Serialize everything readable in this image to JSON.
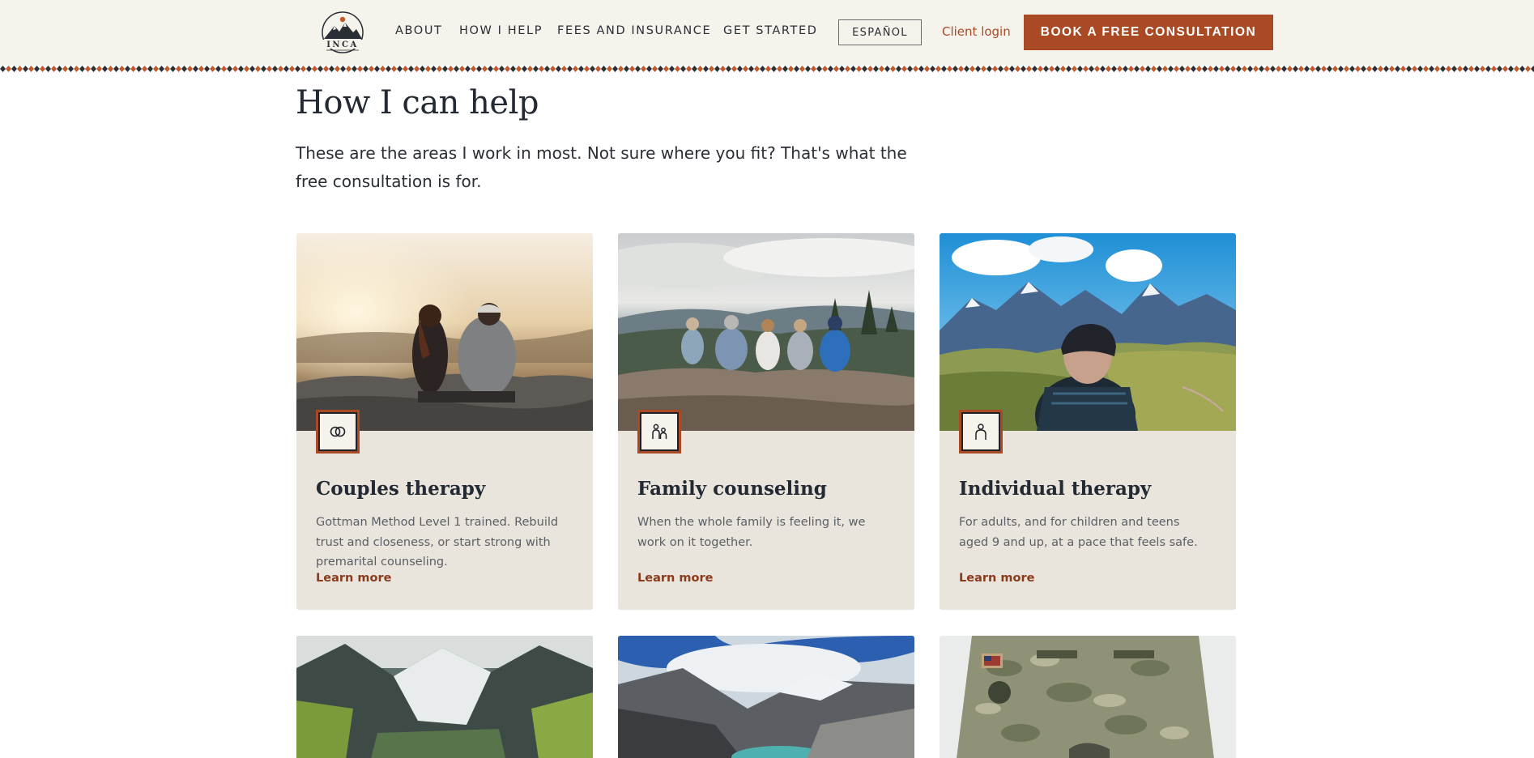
{
  "header": {
    "logo_text": "INCA",
    "nav": [
      {
        "label": "ABOUT"
      },
      {
        "label": "HOW I HELP"
      },
      {
        "label": "FEES AND INSURANCE"
      },
      {
        "label": "GET STARTED"
      }
    ],
    "language_label": "ESPAÑOL",
    "client_login_label": "Client login",
    "cta_label": "BOOK A FREE CONSULTATION"
  },
  "main": {
    "title": "How I can help",
    "intro": "These are the areas I work in most. Not sure where you fit? That's what the free consultation is for.",
    "cards": [
      {
        "icon": "rings-icon",
        "title": "Couples therapy",
        "description": "Gottman Method Level 1 trained. Rebuild trust and closeness, or start strong with premarital counseling.",
        "link": "Learn more"
      },
      {
        "icon": "family-icon",
        "title": "Family counseling",
        "description": "When the whole family is feeling it, we work on it together.",
        "link": "Learn more"
      },
      {
        "icon": "person-icon",
        "title": "Individual therapy",
        "description": "For adults, and for children and teens aged 9 and up, at a pace that feels safe.",
        "link": "Learn more"
      }
    ]
  },
  "colors": {
    "accent": "#a94a24",
    "header_bg": "#f6f2ec",
    "card_bg": "#e9e4dc",
    "text_dark": "#232a33"
  }
}
